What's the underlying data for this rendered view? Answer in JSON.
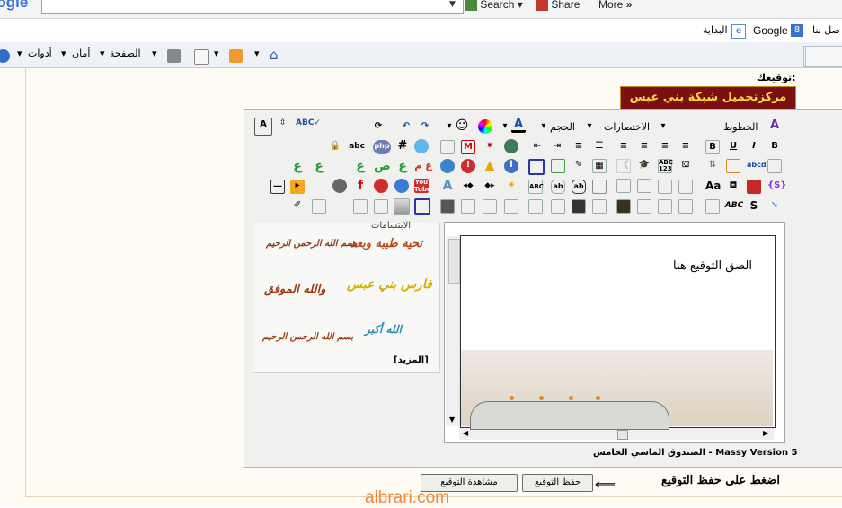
{
  "browser": {
    "google_logo": "oogle",
    "search_label": "Search",
    "share_label": "Share",
    "more_label": "More",
    "google_link": "Google",
    "home_link": "البداية",
    "contact_link": "صل بنا",
    "commands": {
      "page": "الصفحة",
      "safety": "أمان",
      "tools": "أدوات"
    }
  },
  "page": {
    "signature_label": "توقيعك:",
    "banner_text": "مركزتحميل شبكة بني عبس",
    "editor": {
      "font_select": "الخطوط",
      "shortcuts_select": "الاختصارات",
      "size_select": "الحجم",
      "smilies_title": "الابتسامات",
      "smilies": [
        "تحية طيبة وبعد",
        "بسم الله الرحمن الرحيم",
        "فارس بني عبس",
        "والله الموفق",
        "الله أكبر",
        "بسم الله الرحمن الرحيم"
      ],
      "more_link": "[المزيد]",
      "placeholder": "الصق التوقيع هنا",
      "version": "الصندوق الماسي الخامس - Massy Version 5"
    },
    "hint": "اضغط على حفظ التوقيع",
    "save_button": "حفظ التوقيع",
    "preview_button": "مشاهدة التوقيع",
    "watermark": "albrari.com"
  },
  "colors": {
    "banner_bg": "#7a1010",
    "banner_text": "#ffd84a",
    "watermark": "#ee8a3a",
    "page_bg": "#fdfbf3"
  }
}
